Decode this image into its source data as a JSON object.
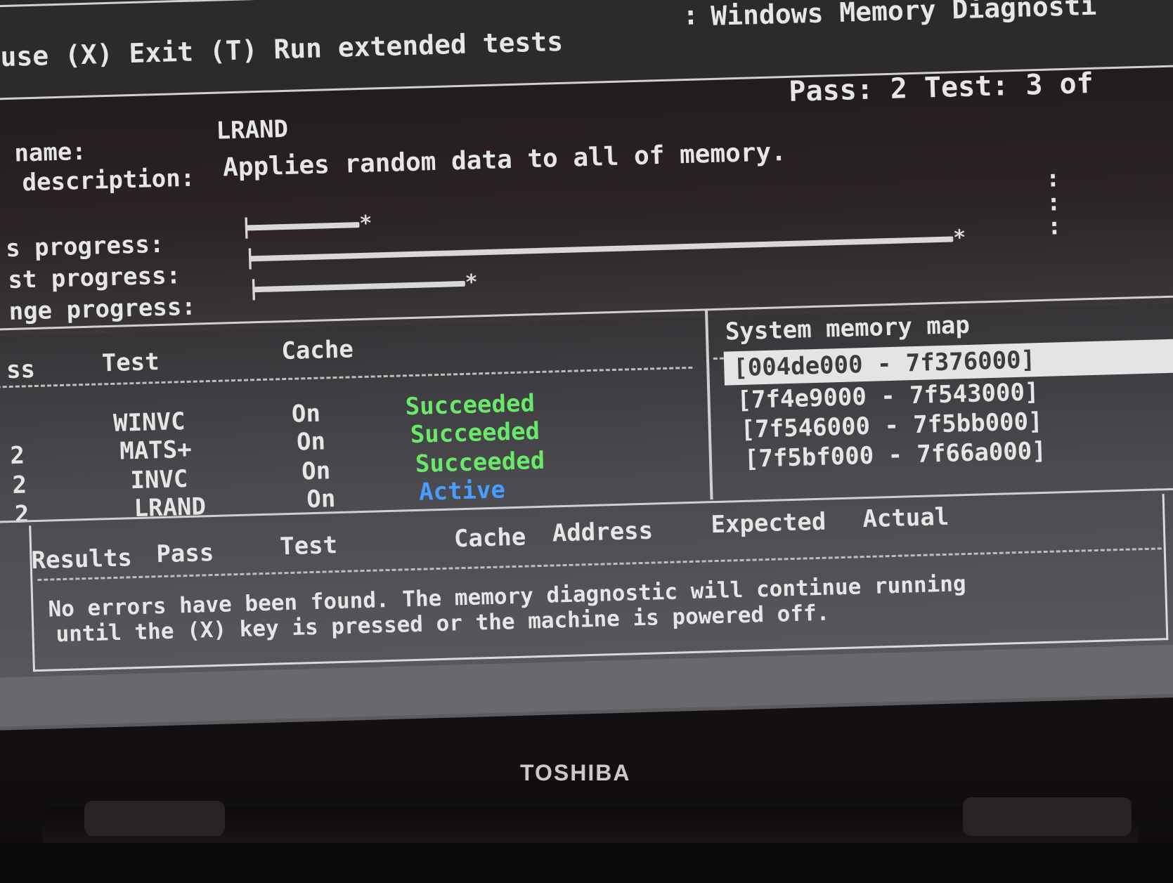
{
  "header": {
    "keys_text": "use (X) Exit (T) Run extended tests",
    "title": "Windows Memory Diagnosti"
  },
  "status": {
    "pass_test_text": "Pass: 2 Test: 3 of"
  },
  "test_info": {
    "name_label": "name:",
    "name_value": "LRAND",
    "description_label": "description:",
    "description_value": "Applies random data to all of memory."
  },
  "progress": {
    "pass_label": "s progress:",
    "test_label": "st progress:",
    "range_label": "nge progress:",
    "pass_fraction": 0.16,
    "test_fraction": 1.0,
    "range_fraction": 0.3
  },
  "tests_table": {
    "headers": {
      "pass": "ss",
      "test": "Test",
      "cache": "Cache"
    },
    "rows": [
      {
        "pass": "",
        "test": "WINVC",
        "cache": "On",
        "status": "Succeeded"
      },
      {
        "pass": "2",
        "test": "MATS+",
        "cache": "On",
        "status": "Succeeded"
      },
      {
        "pass": "2",
        "test": "INVC",
        "cache": "On",
        "status": "Succeeded"
      },
      {
        "pass": "2",
        "test": "LRAND",
        "cache": "On",
        "status": "Active"
      }
    ]
  },
  "memory_map": {
    "title": "System memory map",
    "ranges": [
      "[004de000 - 7f376000]",
      "[7f4e9000 - 7f543000]",
      "[7f546000 - 7f5bb000]",
      "[7f5bf000 - 7f66a000]"
    ]
  },
  "results": {
    "headers": {
      "results": "Results",
      "pass": "Pass",
      "test": "Test",
      "cache": "Cache",
      "address": "Address",
      "expected": "Expected",
      "actual": "Actual"
    },
    "message_line1": "No errors have been found. The memory diagnostic will continue running",
    "message_line2": "until the (X) key is pressed or the machine is powered off."
  },
  "laptop": {
    "brand": "TOSHIBA"
  },
  "colors": {
    "succeeded": "#69e86a",
    "active": "#4a9dff",
    "text": "#e6e6e6"
  }
}
